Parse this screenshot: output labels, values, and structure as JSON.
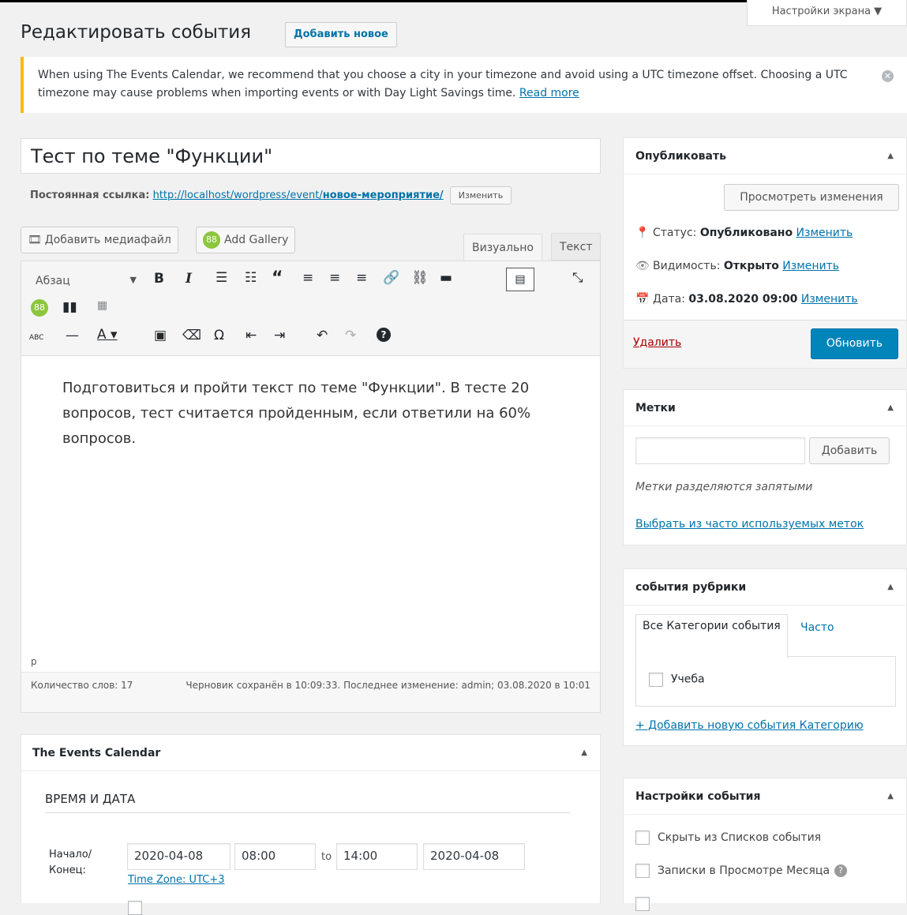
{
  "screen_options": "Настройки экрана ▼",
  "page": {
    "title": "Редактировать события",
    "add_new": "Добавить новое"
  },
  "notice": {
    "text": "When using The Events Calendar, we recommend that you choose a city in your timezone and avoid using a UTC timezone offset. Choosing a UTC timezone may cause problems when importing events or with Day Light Savings time. ",
    "link": "Read more"
  },
  "post": {
    "title": "Тест по теме \"Функции\"",
    "permalink_label": "Постоянная ссылка:",
    "permalink_base": "http://localhost/wordpress/event/",
    "permalink_slug": "новое-мероприятие/",
    "permalink_edit": "Изменить"
  },
  "media": {
    "add_media": "Добавить медиафайл",
    "add_gallery": "Add Gallery"
  },
  "tabs": {
    "visual": "Визуально",
    "text": "Текст"
  },
  "editor": {
    "format": "Абзац",
    "content": "Подготовиться и пройти текст по теме \"Функции\". В тесте 20 вопросов, тест считается пройденным, если ответили на 60% вопросов.",
    "path": "p",
    "word_count": "Количество слов: 17",
    "saved": "Черновик сохранён в 10:09:33. Последнее изменение: admin; 03.08.2020 в 10:01"
  },
  "publish": {
    "title": "Опубликовать",
    "preview": "Просмотреть изменения",
    "status_label": "Статус:",
    "status_value": "Опубликовано",
    "visibility_label": "Видимость:",
    "visibility_value": "Открыто",
    "date_label": "Дата:",
    "date_value": "03.08.2020 09:00",
    "edit": "Изменить",
    "delete": "Удалить",
    "update": "Обновить"
  },
  "tags": {
    "title": "Метки",
    "input": "",
    "add": "Добавить",
    "hint": "Метки разделяются запятыми",
    "choose": "Выбрать из часто используемых меток"
  },
  "categories": {
    "title": "события рубрики",
    "tab_all": "Все Категории события",
    "tab_popular": "Часто используемые",
    "items": [
      {
        "label": "Учеба",
        "checked": false
      }
    ],
    "add_new": "+ Добавить новую события Категорию"
  },
  "event_settings": {
    "title": "Настройки события",
    "options": [
      {
        "label": "Скрыть из Списков события",
        "help": false
      },
      {
        "label": "Записки в Просмотре Месяца",
        "help": true
      }
    ]
  },
  "tec": {
    "title": "The Events Calendar",
    "section": "ВРЕМЯ И ДАТА",
    "start_end_label": "Начало/ Конец:",
    "start_date": "2020-04-08",
    "start_time": "08:00",
    "to": "to",
    "end_time": "14:00",
    "end_date": "2020-04-08",
    "timezone": "Time Zone: UTC+3"
  }
}
